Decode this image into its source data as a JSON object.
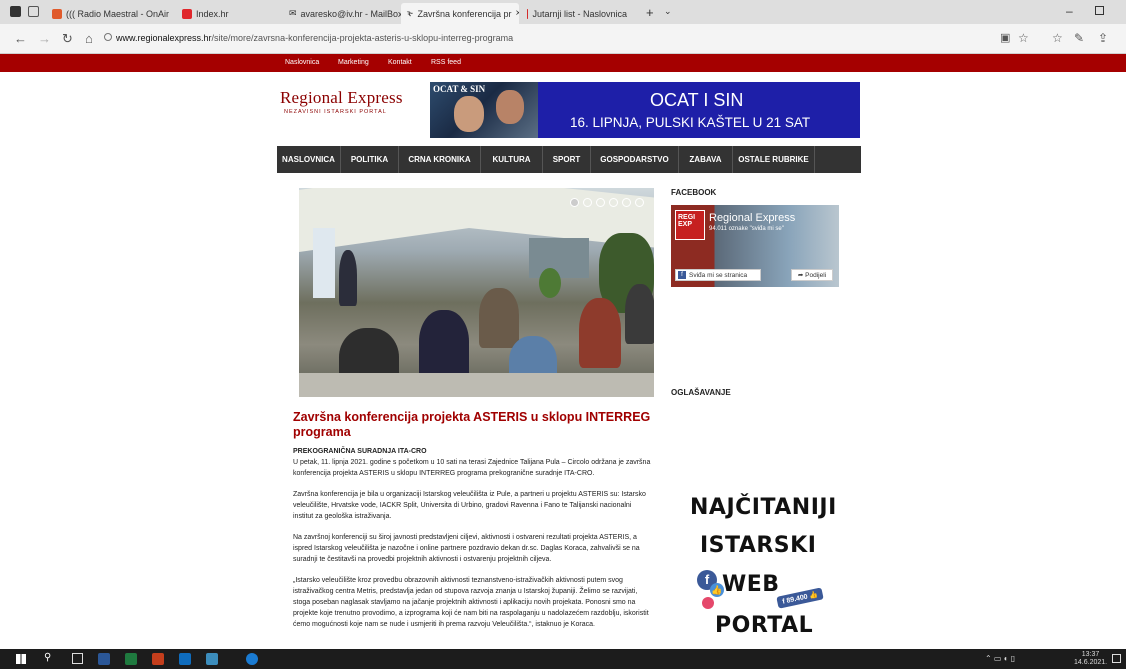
{
  "browser": {
    "tabs": [
      {
        "label": "(((  Radio Maestral - OnAir",
        "color": "#e05a2b"
      },
      {
        "label": "Index.hr",
        "color": "#e0262b"
      },
      {
        "label": "avaresko@iv.hr - MailBox - I",
        "color": "#555555"
      },
      {
        "label": "Završna konferencija pr",
        "color": "#333333",
        "active": true
      },
      {
        "label": "Jutarnji list - Naslovnica",
        "color": "#d42b2b"
      }
    ],
    "url_prefix": "www.regionalexpress.hr",
    "url_rest": "/site/more/zavrsna-konferencija-projekta-asteris-u-sklopu-interreg-programa"
  },
  "topnav": [
    "Naslovnica",
    "Marketing",
    "Kontakt",
    "RSS feed"
  ],
  "logo": {
    "title": "Regional Express",
    "subtitle": "NEZAVISNI ISTARSKI PORTAL"
  },
  "banner": {
    "image_caption": "OCAT & SIN",
    "line1": "OCAT I SIN",
    "line2": "16. LIPNJA, PULSKI KAŠTEL U 21 SAT"
  },
  "mainnav": [
    "NASLOVNICA",
    "POLITIKA",
    "CRNA KRONIKA",
    "KULTURA",
    "SPORT",
    "GOSPODARSTVO",
    "ZABAVA",
    "OSTALE RUBRIKE"
  ],
  "article": {
    "title": "Završna konferencija projekta ASTERIS u sklopu INTERREG programa",
    "subtitle": "PREKOGRANIČNA SURADNJA ITA-CRO",
    "paragraphs": [
      "U petak, 11. lipnja 2021. godine s početkom u 10 sati na terasi Zajednice Talijana Pula – Circolo održana je završna konferencija projekta ASTERIS u sklopu INTERREG programa prekogranične suradnje ITA-CRO.",
      "Završna konferencija je bila u organizaciji Istarskog veleučilišta iz Pule, a partneri u projektu ASTERIS su: Istarsko veleučilište, Hrvatske vode, IACKR Split, Universita di Urbino, gradovi Ravenna i Fano te Talijanski nacionalni institut za geološka istraživanja.",
      "Na završnoj konferenciji su široj javnosti predstavljeni ciljevi, aktivnosti i ostvareni rezultati projekta ASTERIS, a ispred Istarskog veleučilišta je nazočne i online partnere pozdravio dekan dr.sc. Daglas Koraca, zahvalivši se na suradnji te čestitavši na provedbi projektnih aktivnosti i ostvarenju projektnih ciljeva.",
      "„Istarsko veleučilište kroz provedbu obrazovnih aktivnosti teznanstveno-istraživačkih aktivnosti putem svog istraživačkog centra Metris, predstavlja jedan od stupova razvoja znanja u Istarskoj županiji. Želimo se razvijati, stoga poseban naglasak stavljamo na jačanje projektnih aktivnosti i aplikaciju novih projekata. Ponosni smo na projekte koje trenutno provodimo, a izprograma koji će nam biti na raspolaganju u nadolazećem razdoblju, iskoristit ćemo mogućnosti koje nam se nude i usmjeriti ih prema razvoju Veleučilišta.“, istaknuo je Koraca."
    ]
  },
  "sidebar": {
    "facebook_heading": "FACEBOOK",
    "fb_logo": "REGI EXP",
    "fb_name": "Regional Express",
    "fb_count": "94.011 oznake \"sviđa mi se\"",
    "fb_like": "Sviđa mi se stranica",
    "fb_share": "Podijeli",
    "ads_heading": "OGLAŠAVANJE",
    "ad_lines": [
      "NAJČITANIJI",
      "ISTARSKI",
      "WEB",
      "PORTAL"
    ],
    "ad_badge": "89.400"
  },
  "taskbar": {
    "time": "13:37",
    "date": "14.6.2021."
  }
}
